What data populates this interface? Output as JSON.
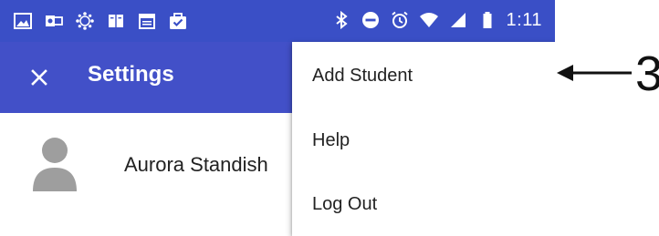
{
  "colors": {
    "status_bar": "#3a4fc6",
    "app_bar": "#4250c8",
    "on_primary": "#ffffff",
    "text_primary": "#222222",
    "avatar_gray": "#9e9e9e"
  },
  "status_bar": {
    "left_icons": [
      "image-icon",
      "outlook-icon",
      "canvas-icon",
      "book-icon",
      "calendar-icon",
      "briefcase-check-icon"
    ],
    "right_icons": [
      "bluetooth-icon",
      "do-not-disturb-icon",
      "alarm-icon",
      "wifi-icon",
      "signal-icon",
      "battery-icon"
    ],
    "time": "1:11"
  },
  "app_bar": {
    "title": "Settings",
    "close_icon": "close-icon"
  },
  "students": [
    {
      "name": "Aurora Standish",
      "avatar_icon": "person-avatar-icon"
    }
  ],
  "overflow_menu": {
    "items": [
      "Add Student",
      "Help",
      "Log Out"
    ]
  },
  "annotation": {
    "number": "3"
  }
}
